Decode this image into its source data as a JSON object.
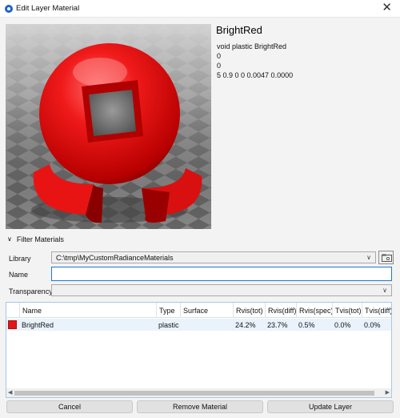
{
  "window": {
    "title": "Edit Layer Material",
    "icon": "app-logo-icon",
    "close_glyph": "✕"
  },
  "material": {
    "name": "BrightRed",
    "definition": [
      "void plastic BrightRed",
      "0",
      "0",
      "5 0.9 0 0 0.0047 0.0000"
    ]
  },
  "filter": {
    "header": "Filter Materials",
    "library_label": "Library",
    "library_value": "C:\\tmp\\MyCustomRadianceMaterials",
    "name_label": "Name",
    "name_value": "",
    "transparency_label": "Transparency",
    "transparency_value": ""
  },
  "table": {
    "columns": [
      "Name",
      "Type",
      "Surface",
      "Rvis(tot)",
      "Rvis(diff)",
      "Rvis(spec)",
      "Tvis(tot)",
      "Tvis(diff)"
    ],
    "rows": [
      {
        "color": "#e01818",
        "name": "BrightRed",
        "type": "plastic",
        "surface": "",
        "rvis_tot": "24.2%",
        "rvis_diff": "23.7%",
        "rvis_spec": "0.5%",
        "tvis_tot": "0.0%",
        "tvis_diff": "0.0%",
        "overflow": "0"
      }
    ]
  },
  "buttons": {
    "cancel": "Cancel",
    "remove": "Remove Material",
    "update": "Update Layer"
  },
  "colors": {
    "accent": "#1979d6",
    "material": "#e01818"
  }
}
